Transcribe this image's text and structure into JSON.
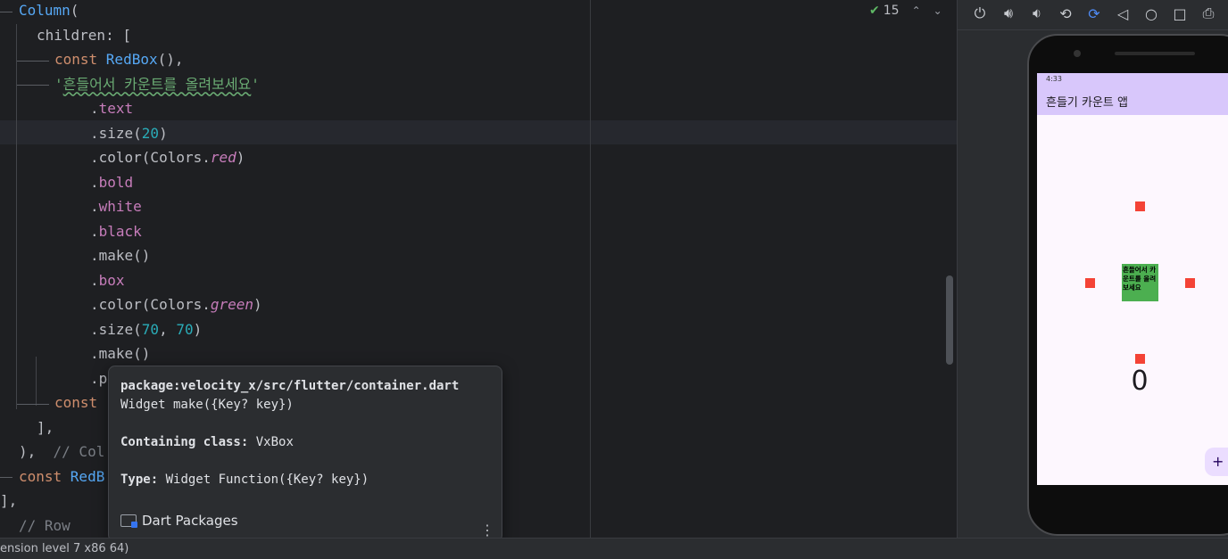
{
  "editor": {
    "lines": [
      {
        "segments": [
          {
            "t": "Column",
            "c": "class"
          },
          {
            "t": "(",
            "c": ""
          }
        ]
      },
      {
        "segments": [
          {
            "t": "children: [",
            "c": ""
          }
        ]
      },
      {
        "segments": [
          {
            "t": "const ",
            "c": "kw"
          },
          {
            "t": "RedBox",
            "c": "class"
          },
          {
            "t": "(),",
            "c": ""
          }
        ]
      },
      {
        "segments": [
          {
            "t": "'",
            "c": "str"
          },
          {
            "t": "흔들어서 카운트를 올려보세요",
            "c": "strko"
          },
          {
            "t": "'",
            "c": "str"
          }
        ]
      },
      {
        "segments": [
          {
            "t": ".",
            "c": ""
          },
          {
            "t": "text",
            "c": "prop"
          }
        ]
      },
      {
        "segments": [
          {
            "t": ".size(",
            "c": ""
          },
          {
            "t": "20",
            "c": "num"
          },
          {
            "t": ")",
            "c": ""
          }
        ]
      },
      {
        "segments": [
          {
            "t": ".color(Colors.",
            "c": ""
          },
          {
            "t": "red",
            "c": "it"
          },
          {
            "t": ")",
            "c": ""
          }
        ]
      },
      {
        "segments": [
          {
            "t": ".",
            "c": ""
          },
          {
            "t": "bold",
            "c": "prop"
          }
        ]
      },
      {
        "segments": [
          {
            "t": ".",
            "c": ""
          },
          {
            "t": "white",
            "c": "prop"
          }
        ]
      },
      {
        "segments": [
          {
            "t": ".",
            "c": ""
          },
          {
            "t": "black",
            "c": "prop"
          }
        ]
      },
      {
        "segments": [
          {
            "t": ".make()",
            "c": ""
          }
        ]
      },
      {
        "segments": [
          {
            "t": ".",
            "c": ""
          },
          {
            "t": "box",
            "c": "prop"
          }
        ]
      },
      {
        "segments": [
          {
            "t": ".color(Colors.",
            "c": ""
          },
          {
            "t": "green",
            "c": "it"
          },
          {
            "t": ")",
            "c": ""
          }
        ]
      },
      {
        "segments": [
          {
            "t": ".size(",
            "c": ""
          },
          {
            "t": "70",
            "c": "num"
          },
          {
            "t": ", ",
            "c": ""
          },
          {
            "t": "70",
            "c": "num"
          },
          {
            "t": ")",
            "c": ""
          }
        ]
      },
      {
        "segments": [
          {
            "t": ".make()",
            "c": ""
          }
        ]
      },
      {
        "segments": [
          {
            "t": ".p",
            "c": ""
          }
        ]
      },
      {
        "segments": [
          {
            "t": "const",
            "c": "kw"
          }
        ]
      },
      {
        "segments": [
          {
            "t": "],",
            "c": ""
          }
        ]
      },
      {
        "segments": [
          {
            "t": "),  ",
            "c": ""
          },
          {
            "t": "// Col",
            "c": "cmt"
          }
        ]
      },
      {
        "segments": [
          {
            "t": "const ",
            "c": "kw"
          },
          {
            "t": "RedB",
            "c": "class"
          }
        ]
      },
      {
        "segments": [
          {
            "t": "],",
            "c": ""
          }
        ]
      },
      {
        "segments": [
          {
            "t": "// Row",
            "c": "cmt"
          }
        ]
      }
    ],
    "inspection_count": "15"
  },
  "tooltip": {
    "package": "package:velocity_x/src/flutter/container.dart",
    "signature": "Widget make({Key? key})",
    "containing_label": "Containing class:",
    "containing_value": " VxBox",
    "type_label": "Type:",
    "type_value": " Widget Function({Key? key})",
    "footer": "Dart Packages"
  },
  "statusbar": {
    "text": "ension level 7 x86 64)"
  },
  "emulator": {
    "toolbar_icons": [
      "power-icon",
      "volume-up-icon",
      "volume-down-icon",
      "rotate-left-icon",
      "rotate-right-icon",
      "back-icon",
      "home-icon",
      "overview-icon",
      "screenshot-icon"
    ],
    "status_time": "4:33",
    "app_title": "흔들기 카운트 앱",
    "box_text": "흔들어서 카운트를 올려보세요",
    "counter": "0",
    "fab": "+"
  },
  "colors": {
    "editor_bg": "#1e1f22",
    "app_bar": "#d8c7fb",
    "red_box": "#f44336",
    "green_box": "#4caf50"
  }
}
